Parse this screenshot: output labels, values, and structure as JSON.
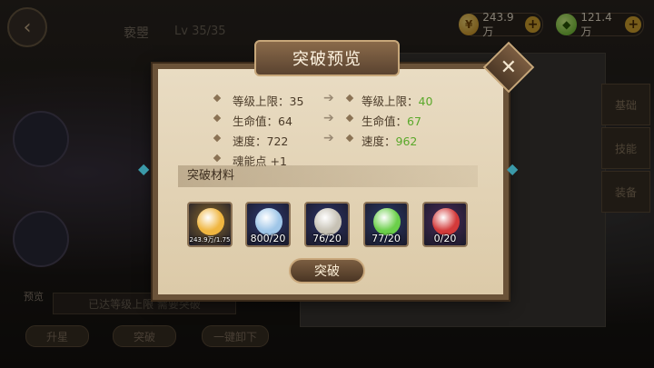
{
  "hero": {
    "name": "亵瞾",
    "level": "Lv 35/35"
  },
  "resources": {
    "gold": "243.9万",
    "gems": "121.4万"
  },
  "background": {
    "side_tabs": [
      "基础",
      "技能",
      "装备"
    ],
    "bottom_buttons": [
      "升星",
      "突破",
      "一键卸下"
    ],
    "preview_label": "预览",
    "maxed_text": "已达等级上限 需要突破"
  },
  "modal": {
    "title": "突破预览",
    "close_label": "✕",
    "stats": [
      {
        "current_label": "等级上限：",
        "current_value": "35",
        "next_label": "等级上限：",
        "next_value": "40"
      },
      {
        "current_label": "生命值：",
        "current_value": "64",
        "next_label": "生命值：",
        "next_value": "67"
      },
      {
        "current_label": "速度：",
        "current_value": "722",
        "next_label": "速度：",
        "next_value": "962"
      },
      {
        "current_label": "魂能点",
        "current_value": "+1"
      }
    ],
    "materials_header": "突破材料",
    "materials": [
      {
        "quantity": "243.9万/1.75",
        "icon": "gold-coin-icon",
        "bg": "#8b6a2a",
        "art": "#f0b640"
      },
      {
        "quantity": "800/20",
        "icon": "armor-icon",
        "bg": "#2e3a72",
        "art": "#9fc6e8"
      },
      {
        "quantity": "76/20",
        "icon": "claw-helmet-icon",
        "bg": "#2d3468",
        "art": "#c7c2b5"
      },
      {
        "quantity": "77/20",
        "icon": "leaf-herb-icon",
        "bg": "#2b3a6a",
        "art": "#6bcf4a"
      },
      {
        "quantity": "0/20",
        "icon": "red-eye-orb-icon",
        "bg": "#4a2a58",
        "art": "#d33a3a"
      }
    ],
    "confirm_label": "突破"
  }
}
